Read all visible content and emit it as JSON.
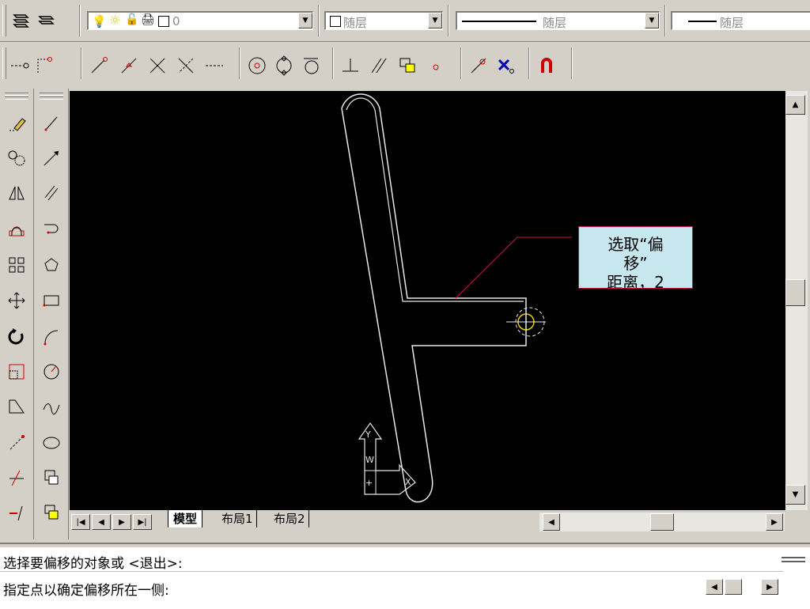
{
  "toolbar_top": {
    "layer_state": "0",
    "color_combo": "随层",
    "linetype_combo": "随层",
    "lineweight_combo": "随层"
  },
  "icons_row1": [
    "layers-manager-icon",
    "layer-previous-icon",
    "lightbulb-icon",
    "sun-icon",
    "lock-icon",
    "plot-icon"
  ],
  "icons_row2": [
    "endpoint-snap-icon",
    "tangent-line-icon",
    "polyline-icon",
    "line-icon",
    "intersection-icon",
    "apparent-intersection-icon",
    "extension-icon",
    "center-icon",
    "quadrant-icon",
    "tangent-icon",
    "perpendicular-icon",
    "parallel-icon",
    "insert-icon",
    "node-icon",
    "nearest-icon",
    "none-snap-icon",
    "magnet-icon"
  ],
  "callout": {
    "line1": "选取“偏",
    "line2": "移”",
    "line3": "距离，2"
  },
  "ucs": {
    "y": "Y",
    "w": "W",
    "x": "X"
  },
  "tabs": {
    "model": "模型",
    "layout1": "布局1",
    "layout2": "布局2"
  },
  "command": {
    "line1": "选择要偏移的对象或 <退出>:",
    "line2": "指定点以确定偏移所在一侧:"
  }
}
